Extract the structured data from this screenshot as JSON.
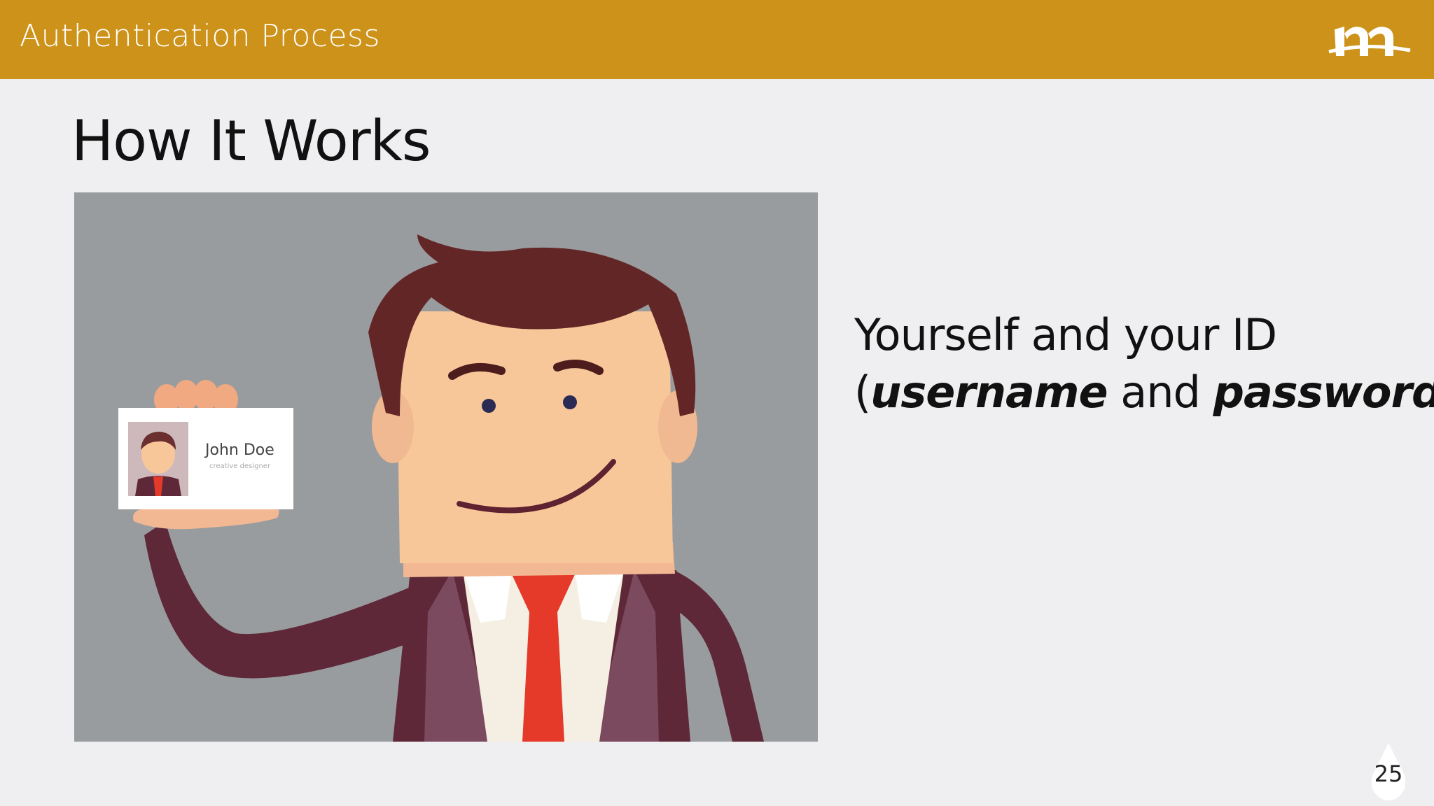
{
  "header": {
    "title": "Authentication Process",
    "background_color": "#cd9219",
    "logo": "m-logo"
  },
  "slide": {
    "title": "How It Works",
    "text_line1": "Yourself and your ID",
    "text_open": "(",
    "text_em1": "username",
    "text_mid": " and ",
    "text_em2": "password",
    "text_close": ")",
    "page_number": "25"
  },
  "illustration": {
    "id_card": {
      "name": "John Doe",
      "role": "creative designer"
    }
  }
}
